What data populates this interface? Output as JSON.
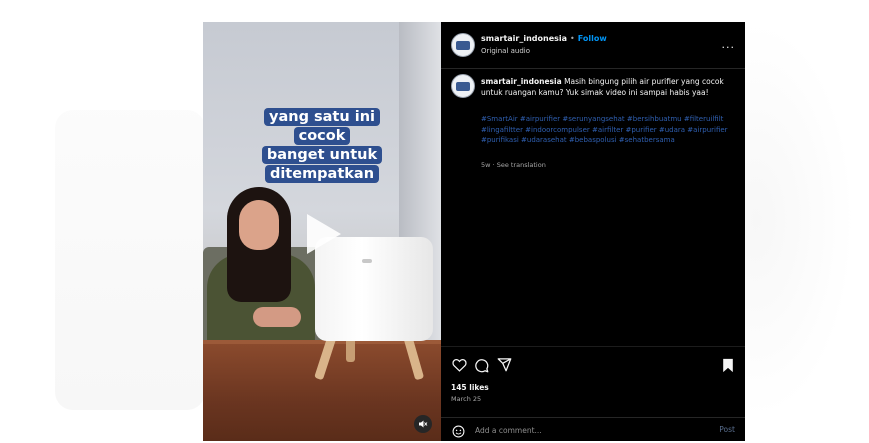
{
  "video": {
    "caption_lines": [
      "yang satu ini cocok",
      "banget untuk",
      "ditempatkan"
    ],
    "play_icon": "play-icon",
    "mute_icon": "speaker-muted-icon"
  },
  "header": {
    "username": "smartair_indonesia",
    "separator": "•",
    "follow_label": "Follow",
    "audio": "Original audio",
    "more_label": "..."
  },
  "comment": {
    "username": "smartair_indonesia",
    "text": "Masih bingung pilih air purifier yang cocok untuk ruangan kamu? Yuk simak video ini sampai habis yaa!",
    "hashtags": "#SmartAir #airpurifier #serunyangsehat #bersihbuatmu #filteruilfilt #lingafiltter #indoorcompulser #airfilter #purifier #udara #airpurifier #purifikasi #udarasehat #bebaspolusi #sehatbersama",
    "time": "5w",
    "see_translation": "See translation"
  },
  "actions": {
    "likes": "145 likes",
    "date": "March 25",
    "comment_placeholder": "Add a comment...",
    "post_label": "Post"
  },
  "colors": {
    "accent_blue": "#0095f6",
    "caption_bg": "#2e4f8f",
    "hashtag": "#2f5fb0",
    "panel_bg": "#000000"
  }
}
